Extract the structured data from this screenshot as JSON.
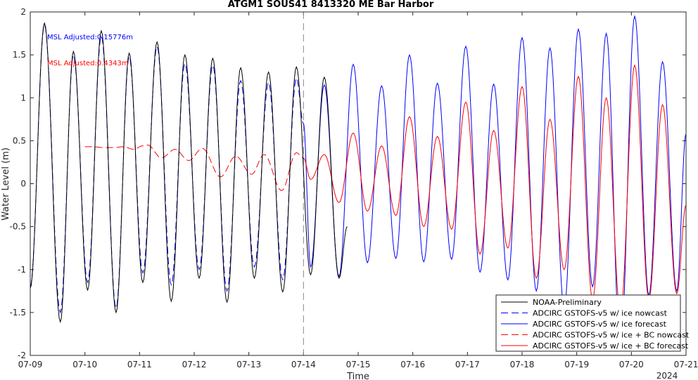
{
  "chart_data": {
    "type": "line",
    "title": "ATGM1 SOUS41 8413320 ME Bar Harbor",
    "xlabel": "Time",
    "ylabel": "Water Level (m)",
    "xlim": [
      0,
      12
    ],
    "ylim": [
      -2,
      2
    ],
    "x_ticks": [
      0,
      1,
      2,
      3,
      4,
      5,
      6,
      7,
      8,
      9,
      10,
      11,
      12
    ],
    "x_tick_labels": [
      "07-09",
      "07-10",
      "07-11",
      "07-12",
      "07-13",
      "07-14",
      "07-15",
      "07-16",
      "07-17",
      "07-18",
      "07-19",
      "07-20",
      "07-21"
    ],
    "x_axis_year_label": "2024",
    "y_ticks": [
      -2,
      -1.5,
      -1,
      -0.5,
      0,
      0.5,
      1,
      1.5,
      2
    ],
    "y_tick_labels": [
      "-2",
      "-1.5",
      "-1",
      "-0.5",
      "0",
      "0.5",
      "1",
      "1.5",
      "2"
    ],
    "vertical_marker_x": 5,
    "annotations": [
      {
        "text": "MSL Adjusted:0.15776m",
        "color": "#0000ff"
      },
      {
        "text": "MSL Adjusted:0.4343m",
        "color": "#ff0000"
      }
    ],
    "legend_position": "bottom-right",
    "series": [
      {
        "name": "NOAA-Preliminary",
        "color": "#000000",
        "style": "solid",
        "x_range": [
          0,
          5.8
        ],
        "extrema": [
          [
            0.0,
            -1.22
          ],
          [
            0.26,
            1.87
          ],
          [
            0.55,
            -1.61
          ],
          [
            0.79,
            1.54
          ],
          [
            1.05,
            -1.24
          ],
          [
            1.3,
            1.78
          ],
          [
            1.57,
            -1.5
          ],
          [
            1.81,
            1.52
          ],
          [
            2.06,
            -1.15
          ],
          [
            2.32,
            1.65
          ],
          [
            2.58,
            -1.37
          ],
          [
            2.83,
            1.5
          ],
          [
            3.09,
            -1.1
          ],
          [
            3.34,
            1.46
          ],
          [
            3.6,
            -1.38
          ],
          [
            3.85,
            1.35
          ],
          [
            4.1,
            -1.1
          ],
          [
            4.36,
            1.3
          ],
          [
            4.62,
            -1.26
          ],
          [
            4.87,
            1.36
          ],
          [
            5.13,
            -1.06
          ],
          [
            5.38,
            1.24
          ],
          [
            5.65,
            -1.1
          ],
          [
            5.8,
            -0.5
          ]
        ]
      },
      {
        "name": "ADCIRC GSTOFS-v5 w/ ice nowcast",
        "color": "#0000ff",
        "style": "dashed",
        "x_range": [
          0,
          5.0
        ],
        "extrema": [
          [
            0.0,
            -1.2
          ],
          [
            0.26,
            1.85
          ],
          [
            0.55,
            -1.5
          ],
          [
            0.79,
            1.5
          ],
          [
            1.05,
            -1.15
          ],
          [
            1.3,
            1.72
          ],
          [
            1.57,
            -1.45
          ],
          [
            1.81,
            1.48
          ],
          [
            2.06,
            -1.04
          ],
          [
            2.32,
            1.6
          ],
          [
            2.58,
            -1.18
          ],
          [
            2.83,
            1.4
          ],
          [
            3.09,
            -1.0
          ],
          [
            3.34,
            1.38
          ],
          [
            3.6,
            -1.25
          ],
          [
            3.85,
            1.2
          ],
          [
            4.1,
            -0.97
          ],
          [
            4.36,
            1.18
          ],
          [
            4.62,
            -1.12
          ],
          [
            4.87,
            1.23
          ],
          [
            5.0,
            0.7
          ]
        ]
      },
      {
        "name": "ADCIRC GSTOFS-v5 w/ ice forecast",
        "color": "#0000ff",
        "style": "solid",
        "x_range": [
          5.0,
          12.0
        ],
        "extrema": [
          [
            5.0,
            0.7
          ],
          [
            5.13,
            -0.97
          ],
          [
            5.38,
            1.15
          ],
          [
            5.65,
            -1.08
          ],
          [
            5.91,
            1.39
          ],
          [
            6.17,
            -0.92
          ],
          [
            6.43,
            1.14
          ],
          [
            6.69,
            -0.87
          ],
          [
            6.94,
            1.5
          ],
          [
            7.2,
            -0.91
          ],
          [
            7.45,
            1.17
          ],
          [
            7.71,
            -0.88
          ],
          [
            7.97,
            1.6
          ],
          [
            8.23,
            -1.03
          ],
          [
            8.48,
            1.16
          ],
          [
            8.74,
            -1.12
          ],
          [
            9.0,
            1.7
          ],
          [
            9.26,
            -1.25
          ],
          [
            9.51,
            1.58
          ],
          [
            9.77,
            -1.45
          ],
          [
            10.03,
            1.8
          ],
          [
            10.29,
            -1.2
          ],
          [
            10.54,
            1.75
          ],
          [
            10.8,
            -1.95
          ],
          [
            11.06,
            1.95
          ],
          [
            11.32,
            -1.3
          ],
          [
            11.57,
            1.42
          ],
          [
            11.83,
            -1.25
          ],
          [
            12.0,
            0.58
          ]
        ]
      },
      {
        "name": "ADCIRC GSTOFS-v5 w/ ice + BC nowcast",
        "color": "#ff0000",
        "style": "dashed",
        "x_range": [
          1.0,
          5.0
        ],
        "extrema": [
          [
            1.0,
            0.43
          ],
          [
            1.15,
            0.43
          ],
          [
            1.35,
            0.42
          ],
          [
            1.55,
            0.42
          ],
          [
            1.7,
            0.43
          ],
          [
            1.9,
            0.4
          ],
          [
            2.05,
            0.44
          ],
          [
            2.15,
            0.45
          ],
          [
            2.4,
            0.3
          ],
          [
            2.65,
            0.4
          ],
          [
            2.9,
            0.27
          ],
          [
            3.15,
            0.41
          ],
          [
            3.48,
            0.08
          ],
          [
            3.76,
            0.32
          ],
          [
            4.05,
            0.11
          ],
          [
            4.28,
            0.34
          ],
          [
            4.6,
            -0.08
          ],
          [
            4.87,
            0.36
          ],
          [
            5.0,
            0.3
          ]
        ]
      },
      {
        "name": "ADCIRC GSTOFS-v5 w/ ice + BC forecast",
        "color": "#ff0000",
        "style": "solid",
        "x_range": [
          5.0,
          12.0
        ],
        "extrema": [
          [
            5.0,
            0.3
          ],
          [
            5.13,
            0.05
          ],
          [
            5.38,
            0.34
          ],
          [
            5.65,
            -0.22
          ],
          [
            5.91,
            0.59
          ],
          [
            6.17,
            -0.32
          ],
          [
            6.43,
            0.44
          ],
          [
            6.69,
            -0.37
          ],
          [
            6.94,
            0.78
          ],
          [
            7.2,
            -0.5
          ],
          [
            7.45,
            0.55
          ],
          [
            7.71,
            -0.53
          ],
          [
            7.97,
            0.95
          ],
          [
            8.23,
            -0.82
          ],
          [
            8.48,
            0.62
          ],
          [
            8.74,
            -0.75
          ],
          [
            9.0,
            1.13
          ],
          [
            9.26,
            -1.1
          ],
          [
            9.51,
            0.75
          ],
          [
            9.77,
            -1.0
          ],
          [
            10.03,
            1.25
          ],
          [
            10.29,
            -1.35
          ],
          [
            10.54,
            1.0
          ],
          [
            10.8,
            -1.5
          ],
          [
            11.06,
            1.38
          ],
          [
            11.32,
            -1.35
          ],
          [
            11.57,
            0.92
          ],
          [
            11.83,
            -1.28
          ],
          [
            12.0,
            -0.25
          ]
        ]
      }
    ]
  }
}
